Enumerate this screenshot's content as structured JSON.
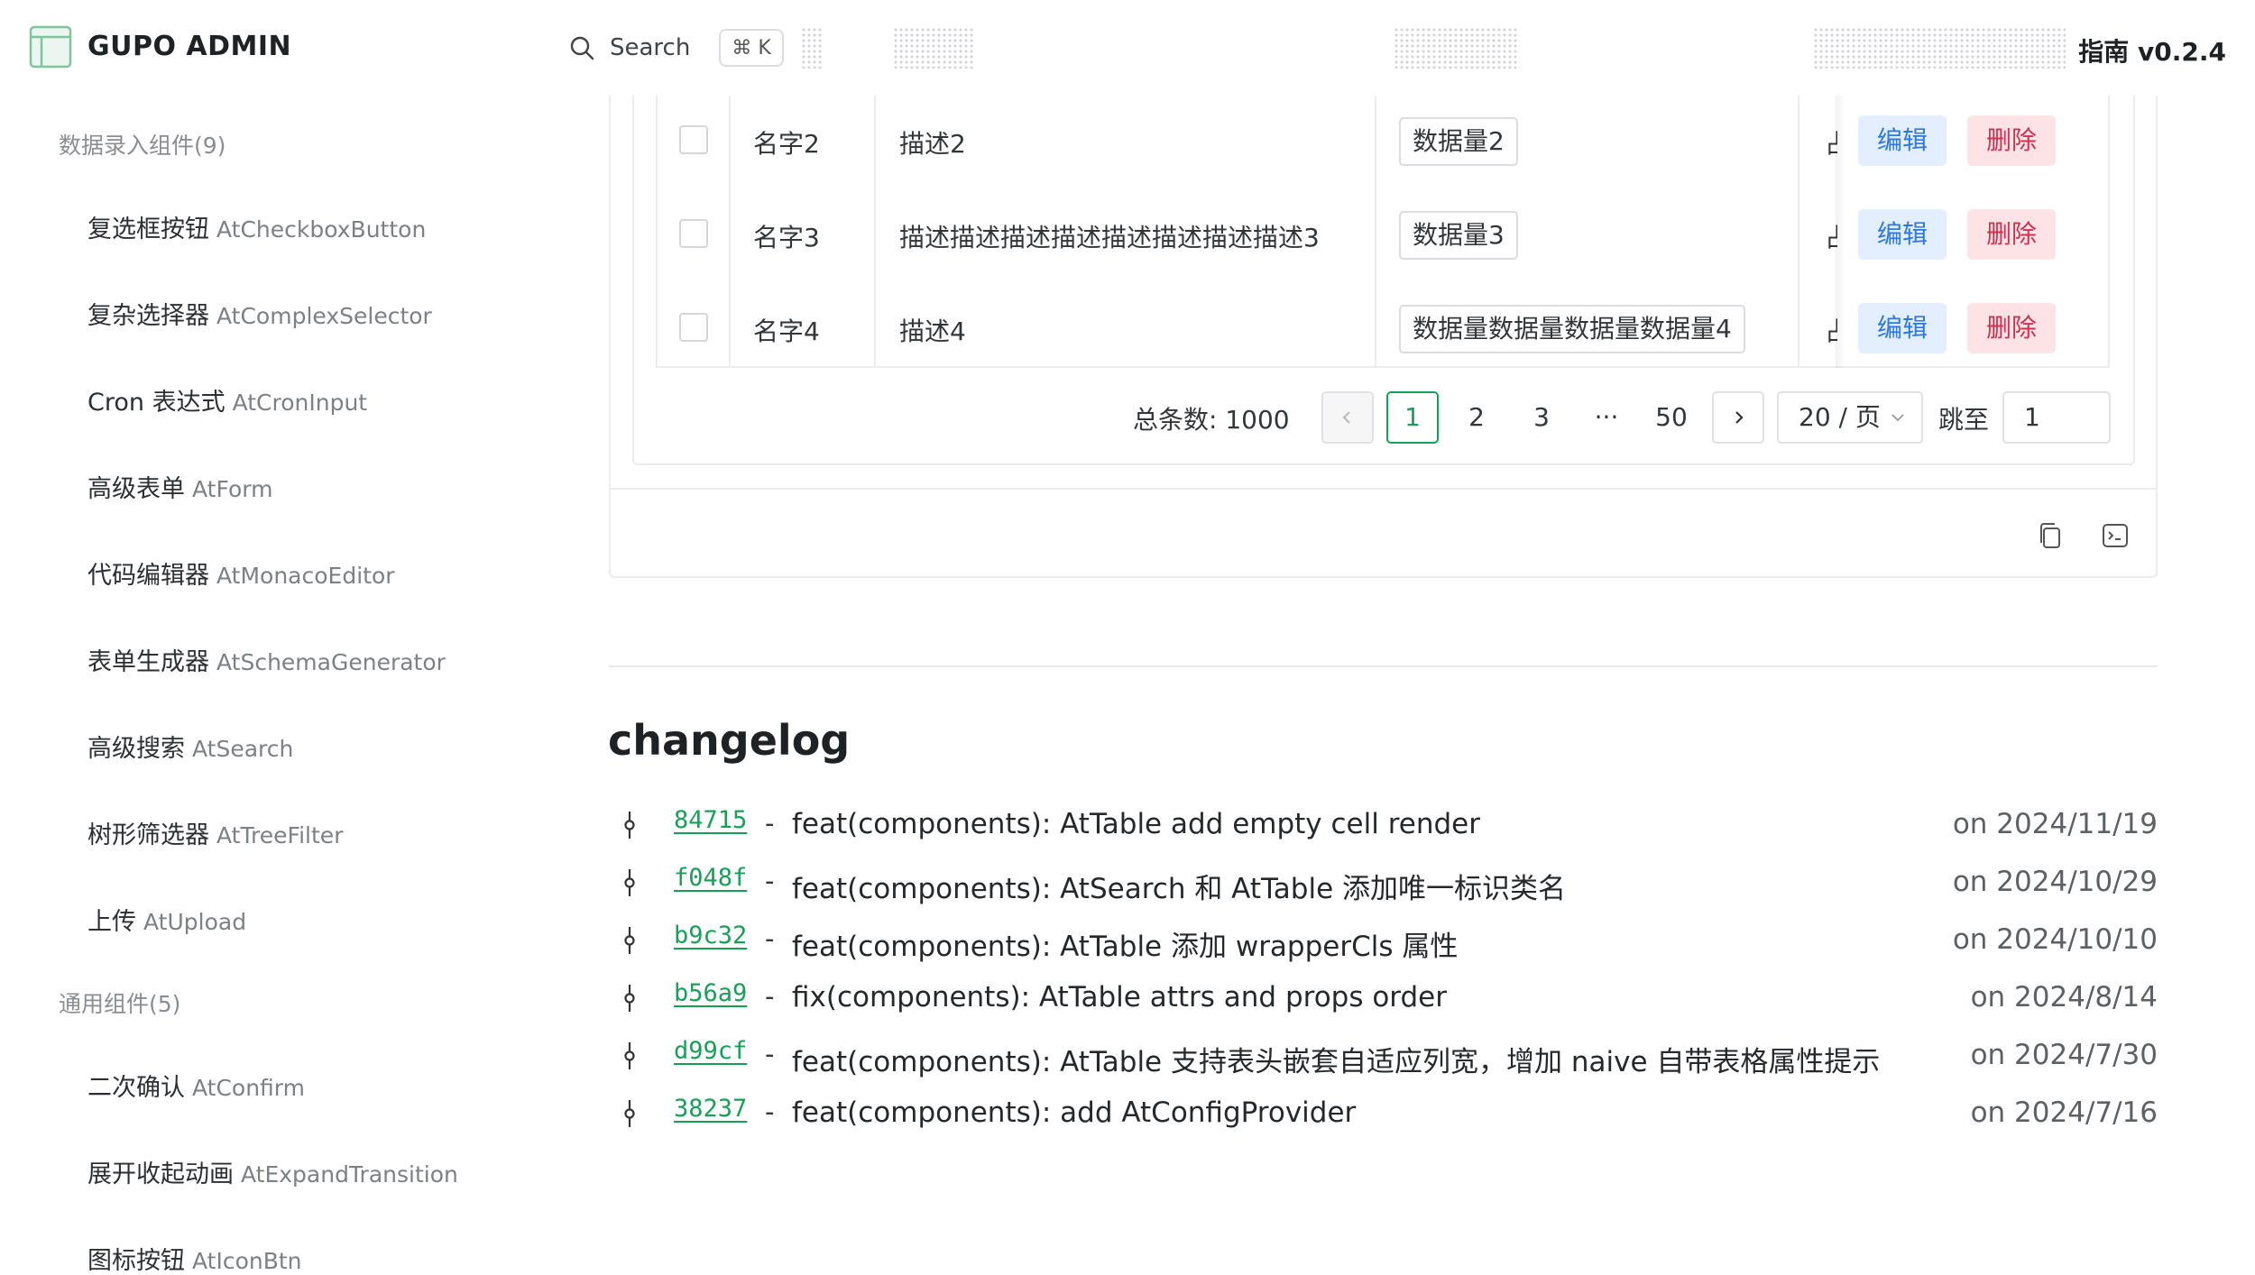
{
  "header": {
    "brand": "GUPO ADMIN",
    "search_label": "Search",
    "search_shortcut": "⌘ K",
    "guide_label": "指南 v0.2.4"
  },
  "sidebar": {
    "groups": [
      {
        "title": "数据录入组件(9)",
        "items": [
          {
            "zh": "复选框按钮",
            "en": "AtCheckboxButton"
          },
          {
            "zh": "复杂选择器",
            "en": "AtComplexSelector"
          },
          {
            "zh": "Cron 表达式",
            "en": "AtCronInput"
          },
          {
            "zh": "高级表单",
            "en": "AtForm"
          },
          {
            "zh": "代码编辑器",
            "en": "AtMonacoEditor"
          },
          {
            "zh": "表单生成器",
            "en": "AtSchemaGenerator"
          },
          {
            "zh": "高级搜索",
            "en": "AtSearch"
          },
          {
            "zh": "树形筛选器",
            "en": "AtTreeFilter"
          },
          {
            "zh": "上传",
            "en": "AtUpload"
          }
        ]
      },
      {
        "title": "通用组件(5)",
        "items": [
          {
            "zh": "二次确认",
            "en": "AtConfirm"
          },
          {
            "zh": "展开收起动画",
            "en": "AtExpandTransition"
          },
          {
            "zh": "图标按钮",
            "en": "AtIconBtn"
          }
        ]
      }
    ]
  },
  "table": {
    "rows": [
      {
        "name": "名字2",
        "desc": "描述2",
        "amount": "数据量2",
        "clipped": "占",
        "edit": "编辑",
        "delete": "删除"
      },
      {
        "name": "名字3",
        "desc": "描述描述描述描述描述描述描述描述3",
        "amount": "数据量3",
        "clipped": "占",
        "edit": "编辑",
        "delete": "删除"
      },
      {
        "name": "名字4",
        "desc": "描述4",
        "amount": "数据量数据量数据量数据量4",
        "clipped": "占",
        "edit": "编辑",
        "delete": "删除"
      }
    ]
  },
  "pagination": {
    "total_label": "总条数:",
    "total_value": "1000",
    "pages": [
      "1",
      "2",
      "3",
      "···",
      "50"
    ],
    "current_page": "1",
    "page_size": "20 / 页",
    "jump_label": "跳至",
    "jump_value": "1"
  },
  "changelog": {
    "title": "changelog",
    "entries": [
      {
        "hash": "84715",
        "message": "feat(components): AtTable add empty cell render",
        "date": "on 2024/11/19"
      },
      {
        "hash": "f048f",
        "message": "feat(components): AtSearch 和 AtTable 添加唯一标识类名",
        "date": "on 2024/10/29"
      },
      {
        "hash": "b9c32",
        "message": "feat(components): AtTable 添加 wrapperCls 属性",
        "date": "on 2024/10/10"
      },
      {
        "hash": "b56a9",
        "message": "fix(components): AtTable attrs and props order",
        "date": "on 2024/8/14"
      },
      {
        "hash": "d99cf",
        "message": "feat(components): AtTable 支持表头嵌套自适应列宽，增加 naive 自带表格属性提示",
        "date": "on 2024/7/30"
      },
      {
        "hash": "38237",
        "message": "feat(components): add AtConfigProvider",
        "date": "on 2024/7/16"
      }
    ]
  },
  "colors": {
    "accent_green": "#18a058",
    "edit_blue": "#2b78e4",
    "delete_red": "#d03050"
  },
  "icons": [
    "logo-icon",
    "search-icon",
    "chevron-left-icon",
    "chevron-right-icon",
    "chevron-down-icon",
    "copy-icon",
    "code-icon",
    "git-commit-icon"
  ]
}
